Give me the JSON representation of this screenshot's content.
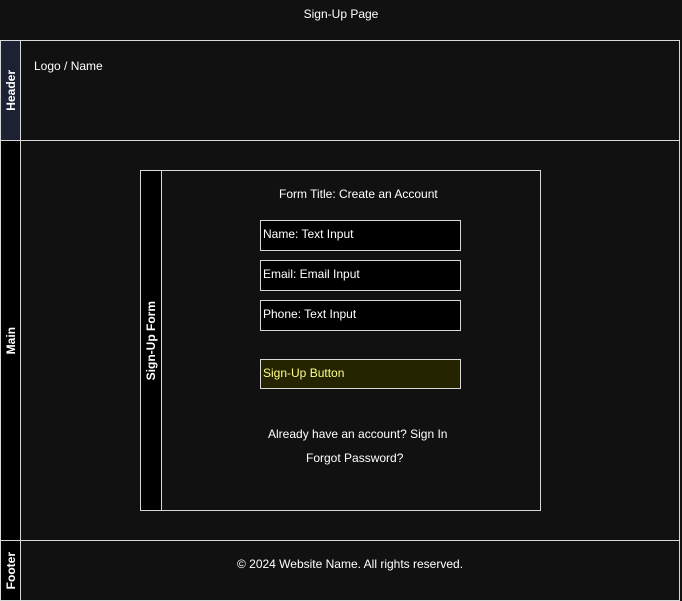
{
  "page": {
    "title": "Sign-Up Page"
  },
  "header": {
    "label": "Header",
    "logo_text": "Logo / Name"
  },
  "main": {
    "label": "Main",
    "form": {
      "label": "Sign-Up Form",
      "title": "Form Title: Create an Account",
      "fields": {
        "name": "Name: Text Input",
        "email": "Email: Email Input",
        "phone": "Phone: Text Input"
      },
      "button_label": "Sign-Up Button",
      "signin_text": "Already have an account? Sign In",
      "forgot_text": "Forgot Password?"
    }
  },
  "footer": {
    "label": "Footer",
    "copyright": "© 2024 Website Name. All rights reserved."
  },
  "colors": {
    "background": "#111111",
    "border": "#d8d8d8",
    "header_label_bg": "#1c2133",
    "button_bg": "#242400",
    "button_text": "#ffff88"
  }
}
